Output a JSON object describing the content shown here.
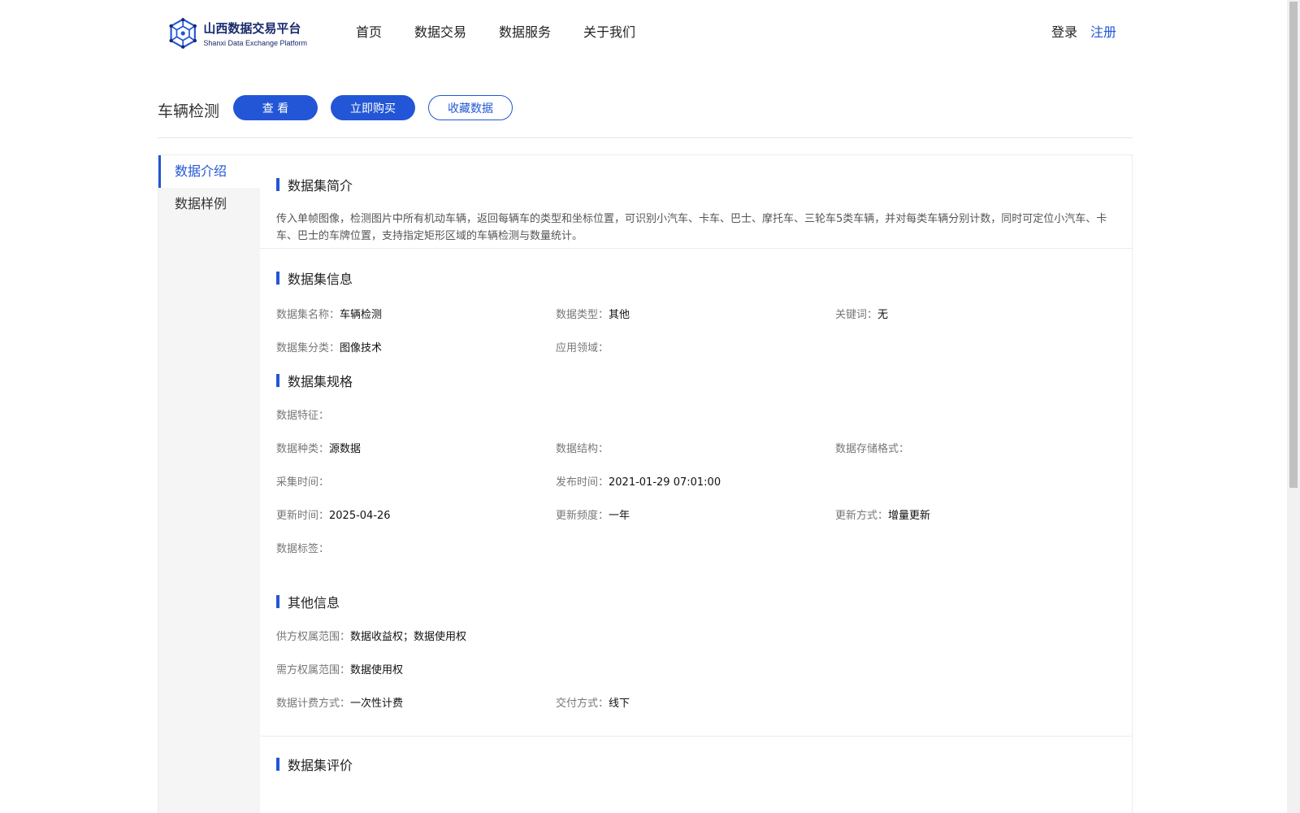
{
  "header": {
    "logo_cn": "山西数据交易平台",
    "logo_en": "Shanxi Data Exchange Platform",
    "nav": [
      "首页",
      "数据交易",
      "数据服务",
      "关于我们"
    ],
    "login": "登录",
    "register": "注册"
  },
  "title_bar": {
    "title": "车辆检测",
    "view_btn": "查 看",
    "buy_btn": "立即购买",
    "fav_btn": "收藏数据"
  },
  "sidebar": {
    "items": [
      {
        "label": "数据介绍",
        "active": true
      },
      {
        "label": "数据样例",
        "active": false
      }
    ]
  },
  "intro": {
    "title": "数据集简介",
    "text": "传入单帧图像，检测图片中所有机动车辆，返回每辆车的类型和坐标位置，可识别小汽车、卡车、巴士、摩托车、三轮车5类车辆，并对每类车辆分别计数，同时可定位小汽车、卡车、巴士的车牌位置，支持指定矩形区域的车辆检测与数量统计。"
  },
  "info": {
    "title": "数据集信息",
    "name_k": "数据集名称：",
    "name_v": "车辆检测",
    "type_k": "数据类型：",
    "type_v": "其他",
    "kw_k": "关键词：",
    "kw_v": "无",
    "cat_k": "数据集分类：",
    "cat_v": "图像技术",
    "field_k": "应用领域：",
    "field_v": ""
  },
  "spec": {
    "title": "数据集规格",
    "feature_k": "数据特征：",
    "feature_v": "",
    "kind_k": "数据种类：",
    "kind_v": "源数据",
    "struct_k": "数据结构：",
    "struct_v": "",
    "format_k": "数据存储格式：",
    "format_v": "",
    "collect_k": "采集时间：",
    "collect_v": "",
    "publish_k": "发布时间：",
    "publish_v": "2021-01-29 07:01:00",
    "update_k": "更新时间：",
    "update_v": "2025-04-26",
    "freq_k": "更新频度：",
    "freq_v": "一年",
    "mode_k": "更新方式：",
    "mode_v": "增量更新",
    "tag_k": "数据标签：",
    "tag_v": ""
  },
  "other": {
    "title": "其他信息",
    "supply_k": "供方权属范围：",
    "supply_v": "数据收益权；数据使用权",
    "demand_k": "需方权属范围：",
    "demand_v": "数据使用权",
    "billing_k": "数据计费方式：",
    "billing_v": "一次性计费",
    "delivery_k": "交付方式：",
    "delivery_v": "线下"
  },
  "review": {
    "title": "数据集评价"
  },
  "colors": {
    "accent": "#2356d6",
    "brand_dark": "#1a2a6c",
    "sidebar_bg": "#f5f5f5"
  }
}
